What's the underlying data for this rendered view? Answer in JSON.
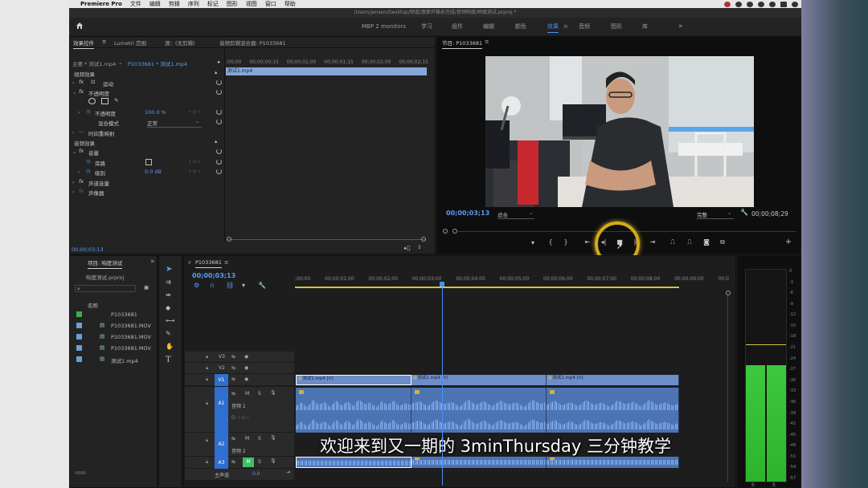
{
  "menubar": {
    "apple": "",
    "app_name": "Premiere Pro",
    "items": [
      "文件",
      "编辑",
      "剪辑",
      "序列",
      "标记",
      "图形",
      "视图",
      "窗口",
      "帮助"
    ]
  },
  "window": {
    "title": "/Users/jensen/Desktop/频道/菠萝开箱未完成/音频响度/响度测试.prproj *"
  },
  "workspaces": {
    "monitor_label": "MBP 2 monitors",
    "items": [
      "学习",
      "组件",
      "编辑",
      "颜色",
      "效果",
      "音频",
      "图形",
      "库"
    ],
    "active": "效果",
    "more": "»"
  },
  "effect_controls": {
    "tabs": [
      "效果控件",
      "Lumetri 范围",
      "源：(无剪辑)",
      "音频剪辑混合器: P1033681"
    ],
    "active_tab": "效果控件",
    "source_label": "主要 * 测试1.mp4",
    "sequence_label": "P1033681 * 测试1.mp4",
    "ruler": [
      ";00;00",
      "00;00;00;15",
      "00;00;01;00",
      "00;00;01;15",
      "00;00;02;00",
      "00;00;02;15"
    ],
    "clip_name": "测试1.mp4",
    "video_effects_header": "视频效果",
    "motion": "运动",
    "opacity": "不透明度",
    "opacity_param": "不透明度",
    "opacity_value": "100.0 %",
    "blend_mode_label": "混合模式",
    "blend_mode_value": "正常",
    "time_remap": "时间重映射",
    "audio_effects_header": "音频效果",
    "volume": "音量",
    "bypass_label": "旁路",
    "level_label": "级别",
    "level_value": "0.0 dB",
    "channel_volume": "声道音量",
    "panner": "声像器",
    "timecode": "00;00;03;13"
  },
  "program_monitor": {
    "tab": "节目: P1033681",
    "timecode": "00;00;03;13",
    "fit": "适合",
    "quality": "完整",
    "duration": "00;00;08;29"
  },
  "project": {
    "tab": "项目: 响度测试",
    "more": "»",
    "file": "响度测试.prproj",
    "column_name": "名称",
    "items": [
      {
        "name": "P1033681",
        "color": "#3fae49"
      },
      {
        "name": "P1033681.MOV",
        "color": "#6a9fd8"
      },
      {
        "name": "P1033681.MOV",
        "color": "#6a9fd8"
      },
      {
        "name": "P1033681.MOV",
        "color": "#6a9fd8"
      },
      {
        "name": "测试1.mp4",
        "color": "#6a9fd8"
      }
    ]
  },
  "timeline": {
    "tab": "P1033681",
    "timecode": "00;00;03;13",
    "ruler": [
      ";00;00",
      "00;00;01;00",
      "00;00;02;00",
      "00;00;03;00",
      "00;00;04;00",
      "00;00;05;00",
      "00;00;06;00",
      "00;00;07;00",
      "00;00;08;00",
      "00;00;09;00",
      "00;0"
    ],
    "tracks": {
      "v3": "V3",
      "v2": "V2",
      "v1": "V1",
      "a1": "A1",
      "a2": "A2",
      "a3": "A3",
      "a1_name": "音频 1",
      "a2_name": "音频 2",
      "master": "主声道",
      "master_value": "0.0",
      "m": "M",
      "s": "S"
    },
    "clip_label": "测试1.mp4 [V]"
  },
  "audio_meter": {
    "scale": [
      "0",
      "-3",
      "-6",
      "-9",
      "-12",
      "-15",
      "-18",
      "-21",
      "-24",
      "-27",
      "-30",
      "-33",
      "-36",
      "-39",
      "-42",
      "-45",
      "-48",
      "-51",
      "-54",
      "-57"
    ],
    "left_label": "S",
    "right_label": "S",
    "level_db": -15
  },
  "subtitle": "欢迎来到又一期的 3minThursday 三分钟教学"
}
